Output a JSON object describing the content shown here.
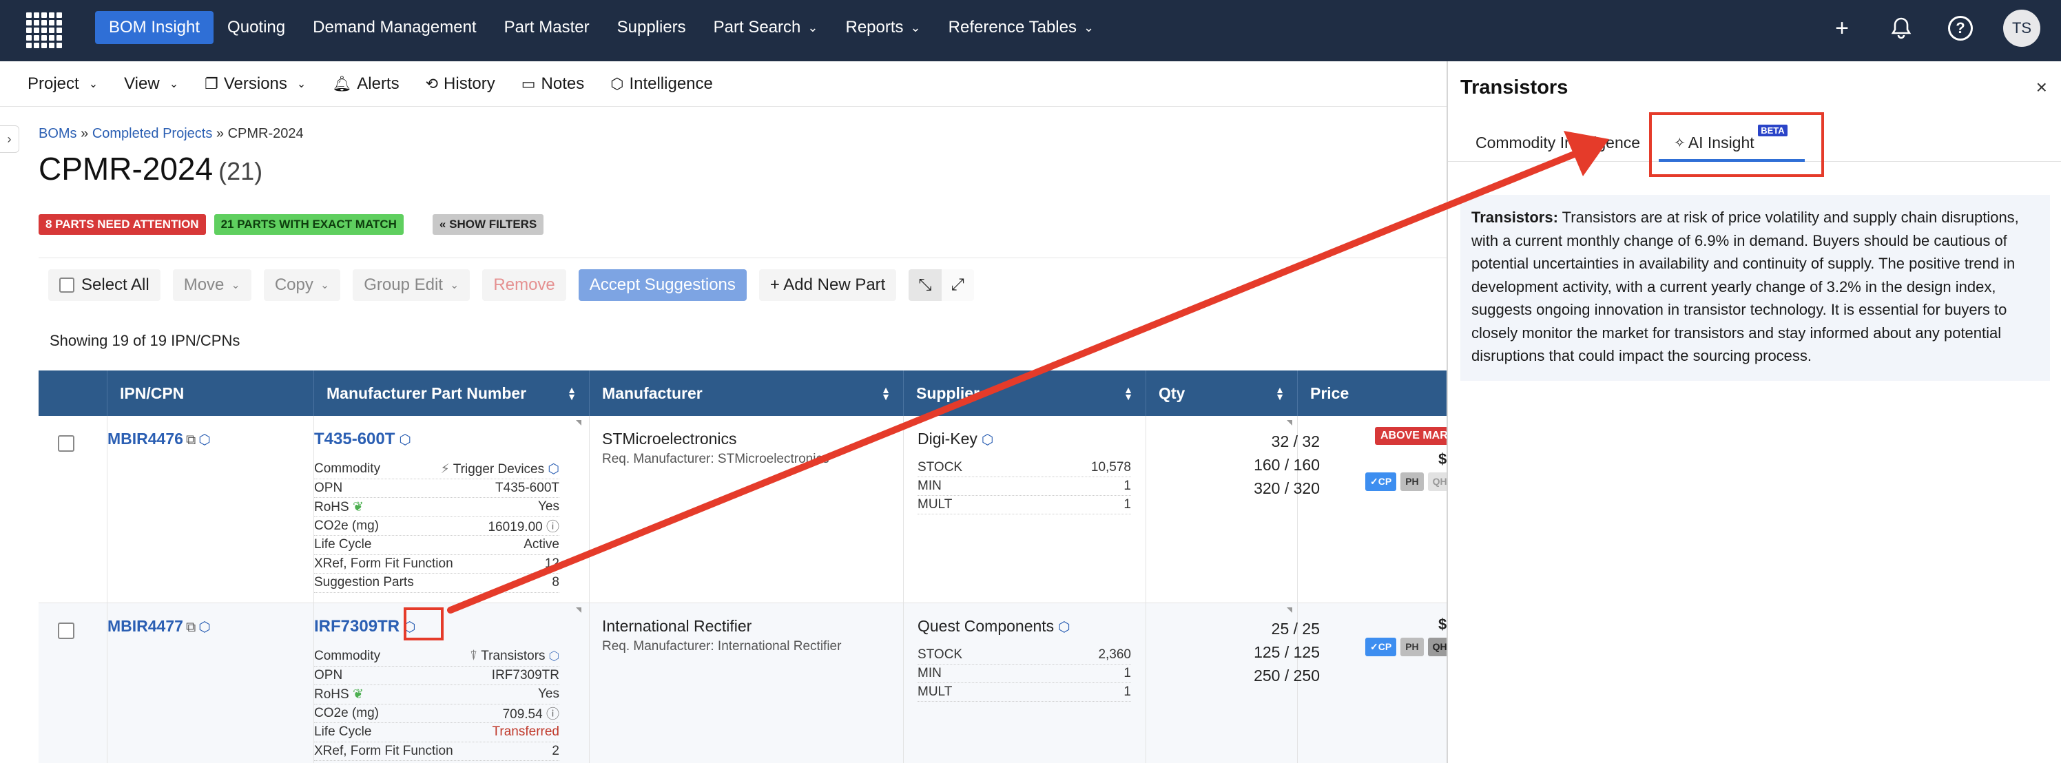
{
  "topnav": {
    "items": [
      {
        "label": "BOM Insight",
        "active": true,
        "chevron": false
      },
      {
        "label": "Quoting",
        "chevron": false
      },
      {
        "label": "Demand Management",
        "chevron": false
      },
      {
        "label": "Part Master",
        "chevron": false
      },
      {
        "label": "Suppliers",
        "chevron": false
      },
      {
        "label": "Part Search",
        "chevron": true
      },
      {
        "label": "Reports",
        "chevron": true
      },
      {
        "label": "Reference Tables",
        "chevron": true
      }
    ],
    "avatar": "TS",
    "icons": [
      "plus-icon",
      "bell-icon",
      "help-icon"
    ]
  },
  "subnav": {
    "project": "Project",
    "view": "View",
    "versions": "Versions",
    "alerts": "Alerts",
    "history": "History",
    "notes": "Notes",
    "intelligence": "Intelligence"
  },
  "breadcrumb": {
    "boms": "BOMs",
    "sep": "»",
    "completed": "Completed Projects",
    "current": "CPMR-2024"
  },
  "page": {
    "title": "CPMR-2024",
    "count": "(21)"
  },
  "badges": {
    "attention": "8 PARTS NEED ATTENTION",
    "exact": "21 PARTS WITH EXACT MATCH",
    "filters": "« SHOW FILTERS"
  },
  "toolbar": {
    "select_all": "Select All",
    "move": "Move",
    "copy": "Copy",
    "group_edit": "Group Edit",
    "remove": "Remove",
    "accept": "Accept Suggestions",
    "add_new": "+ Add New Part"
  },
  "showing": "Showing 19 of 19 IPN/CPNs",
  "table": {
    "headers": [
      "IPN/CPN",
      "Manufacturer Part Number",
      "Manufacturer",
      "Supplier",
      "Qty",
      "Price"
    ],
    "rows": [
      {
        "ipn": "MBIR4476",
        "mpn": "T435-600T",
        "attrs": [
          {
            "k": "Commodity",
            "v": "Trigger Devices"
          },
          {
            "k": "OPN",
            "v": "T435-600T"
          },
          {
            "k": "RoHS",
            "v": "Yes"
          },
          {
            "k": "CO2e (mg)",
            "v": "16019.00"
          },
          {
            "k": "Life Cycle",
            "v": "Active"
          },
          {
            "k": "XRef, Form Fit Function",
            "v": "12"
          },
          {
            "k": "Suggestion Parts",
            "v": "8"
          }
        ],
        "manufacturer": "STMicroelectronics",
        "req_manufacturer": "Req. Manufacturer: STMicroelectronics",
        "supplier": "Digi-Key",
        "supplier_attrs": [
          {
            "k": "STOCK",
            "v": "10,578"
          },
          {
            "k": "MIN",
            "v": "1"
          },
          {
            "k": "MULT",
            "v": "1"
          }
        ],
        "qty": [
          "32 / 32",
          "160 / 160",
          "320 / 320"
        ],
        "price_badge": "ABOVE MARKET",
        "price_chips": [
          "✓CP",
          "PH",
          "QH"
        ]
      },
      {
        "ipn": "MBIR4477",
        "mpn": "IRF7309TR",
        "attrs": [
          {
            "k": "Commodity",
            "v": "Transistors"
          },
          {
            "k": "OPN",
            "v": "IRF7309TR"
          },
          {
            "k": "RoHS",
            "v": "Yes"
          },
          {
            "k": "CO2e (mg)",
            "v": "709.54"
          },
          {
            "k": "Life Cycle",
            "v": "Transferred"
          },
          {
            "k": "XRef, Form Fit Function",
            "v": "2"
          }
        ],
        "manufacturer": "International Rectifier",
        "req_manufacturer": "Req. Manufacturer: International Rectifier",
        "supplier": "Quest Components",
        "supplier_attrs": [
          {
            "k": "STOCK",
            "v": "2,360"
          },
          {
            "k": "MIN",
            "v": "1"
          },
          {
            "k": "MULT",
            "v": "1"
          }
        ],
        "qty": [
          "25 / 25",
          "125 / 125",
          "250 / 250"
        ],
        "price_chips": [
          "✓CP",
          "PH",
          "QH"
        ]
      }
    ]
  },
  "panel": {
    "title": "Transistors",
    "close": "×",
    "tab1": "Commodity Intelligence",
    "tab2": "AI Insight",
    "beta": "BETA",
    "insight_label": "Transistors:",
    "insight_text": "Transistors are at risk of price volatility and supply chain disruptions, with a current monthly change of 6.9% in demand. Buyers should be cautious of potential uncertainties in availability and continuity of supply. The positive trend in development activity, with a current yearly change of 3.2% in the design index, suggests ongoing innovation in transistor technology. It is essential for buyers to closely monitor the market for transistors and stay informed about any potential disruptions that could impact the sourcing process."
  },
  "colors": {
    "nav_bg": "#1f2d44",
    "accent": "#2f6fd6",
    "table_header": "#2d5a8a",
    "annotation_red": "#e53b2a"
  }
}
